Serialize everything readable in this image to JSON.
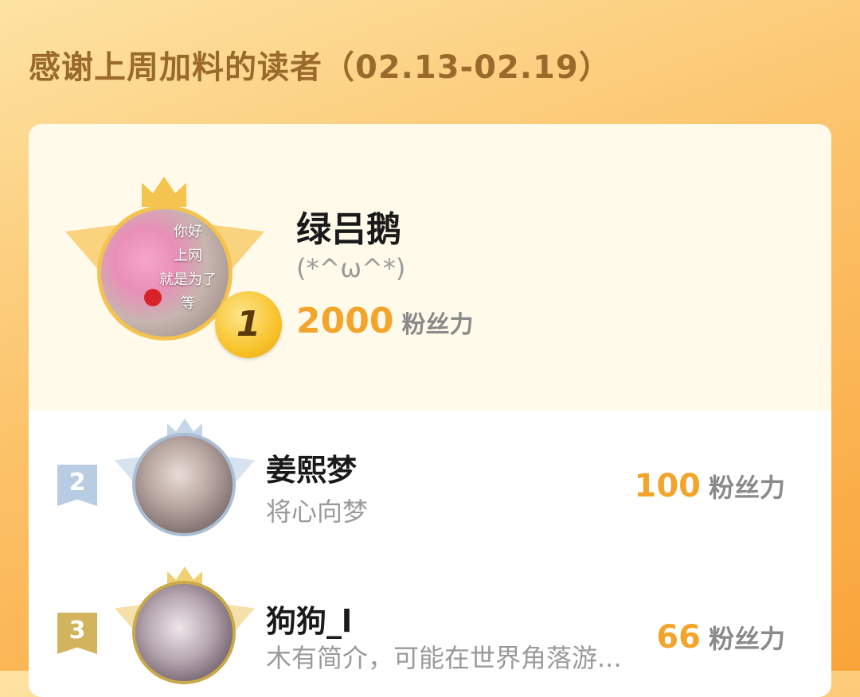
{
  "header": {
    "title": "感谢上周加料的读者（02.13-02.19）"
  },
  "colors": {
    "accent_score": "#f2a52a",
    "gold": "#f5c44f",
    "silver": "#b8cde3",
    "bronze": "#d3b45e"
  },
  "top_reader": {
    "rank": "1",
    "name": "绿吕鹅",
    "bio": "(*^ω^*)",
    "score": "2000",
    "score_unit": "粉丝力",
    "avatar_text": "你好\n上网\n就是为了\n等"
  },
  "readers": [
    {
      "rank": "2",
      "name": "姜熙梦",
      "bio": "将心向梦",
      "score": "100",
      "score_unit": "粉丝力"
    },
    {
      "rank": "3",
      "name": "狗狗_l",
      "bio": "木有简介，可能在世界角落游...",
      "score": "66",
      "score_unit": "粉丝力"
    }
  ]
}
